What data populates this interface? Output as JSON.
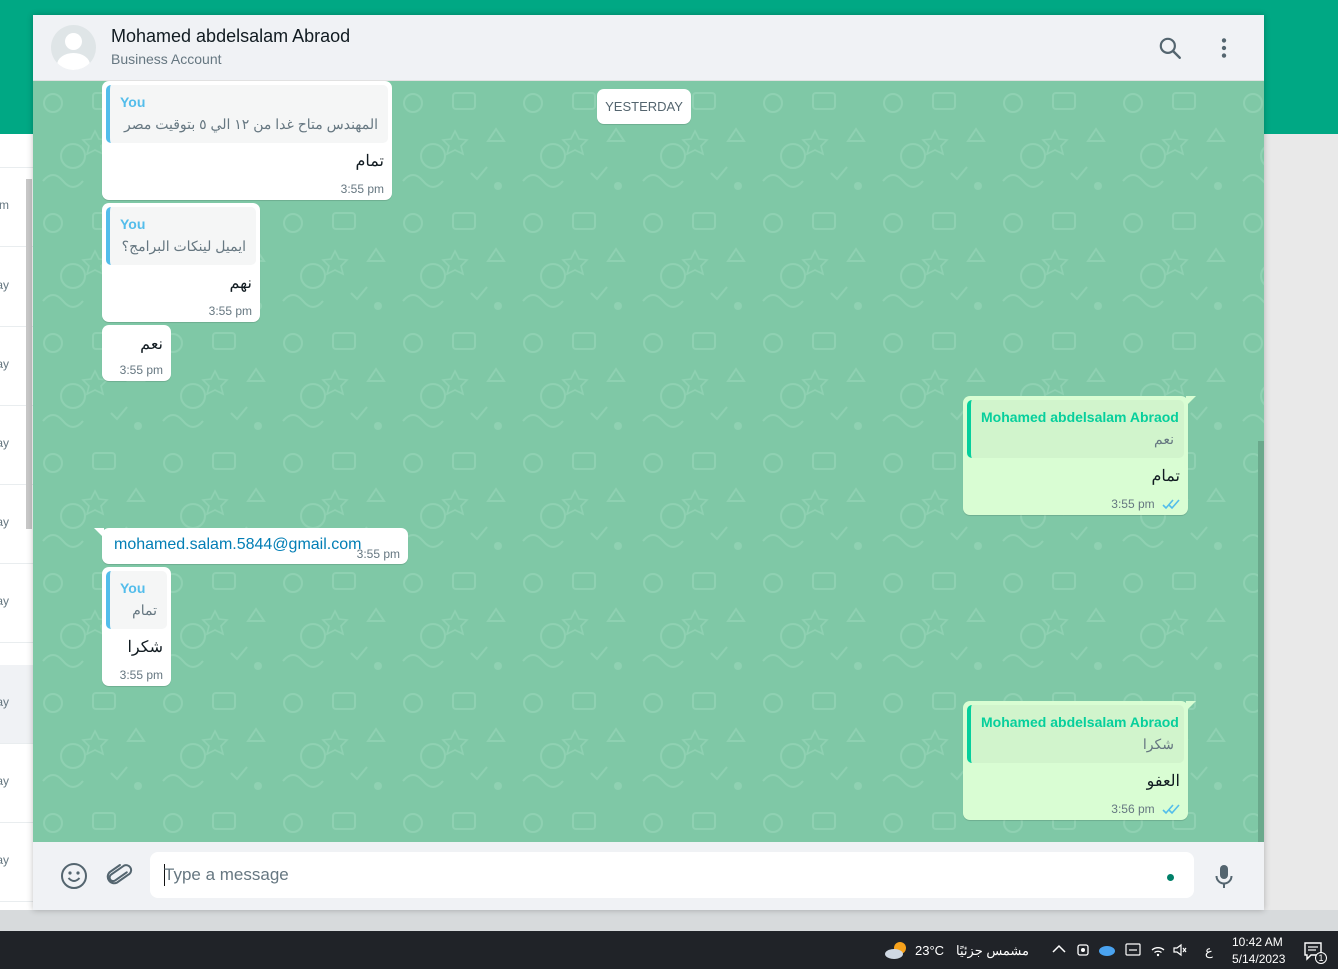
{
  "header": {
    "contact_name": "Mohamed abdelsalam Abraod",
    "contact_subtitle": "Business Account"
  },
  "left_list": {
    "partial_labels": [
      "m",
      "m",
      "ay",
      "ay",
      "ay",
      "ay",
      "ay",
      "ay",
      "ay",
      "ay"
    ]
  },
  "chat": {
    "day_chip": "YESTERDAY",
    "messages": [
      {
        "quote_author": "You",
        "quote_text": "المهندس متاح غدا من ١٢ الي ٥ بتوقيت مصر",
        "text": "تمام",
        "time": "3:55 pm"
      },
      {
        "quote_author": "You",
        "quote_text": "ايميل لينكات البرامج؟",
        "text": "نهم",
        "time": "3:55 pm"
      },
      {
        "text": "نعم",
        "time": "3:55 pm"
      },
      {
        "quote_author": "Mohamed abdelsalam Abraod",
        "quote_text": "نعم",
        "text": "تمام",
        "time": "3:55 pm"
      },
      {
        "link_text": "mohamed.salam.5844@gmail.com",
        "time": "3:55 pm"
      },
      {
        "quote_author": "You",
        "quote_text": "تمام",
        "text": "شكرا",
        "time": "3:55 pm"
      },
      {
        "quote_author": "Mohamed abdelsalam Abraod",
        "quote_text": "شكرا",
        "text": "العفو",
        "time": "3:56 pm"
      }
    ]
  },
  "footer": {
    "input_placeholder": "Type a message",
    "input_value": ""
  },
  "taskbar": {
    "weather_temp": "23°C",
    "weather_desc": "مشمس جزئيًا",
    "lang": "ع",
    "time": "10:42 AM",
    "date": "5/14/2023",
    "notification_count": "1"
  },
  "colors": {
    "brand": "#00a884",
    "chat_bg": "#7fc8a6",
    "out_bubble": "#d9fdd3",
    "in_bubble": "#ffffff",
    "read_ticks": "#53bdeb"
  },
  "icons": [
    "search-icon",
    "menu-dots-icon",
    "emoji-icon",
    "attach-icon",
    "mic-icon",
    "weather-icon",
    "chevron-up-icon",
    "wifi-icon",
    "volume-icon",
    "notification-icon"
  ]
}
